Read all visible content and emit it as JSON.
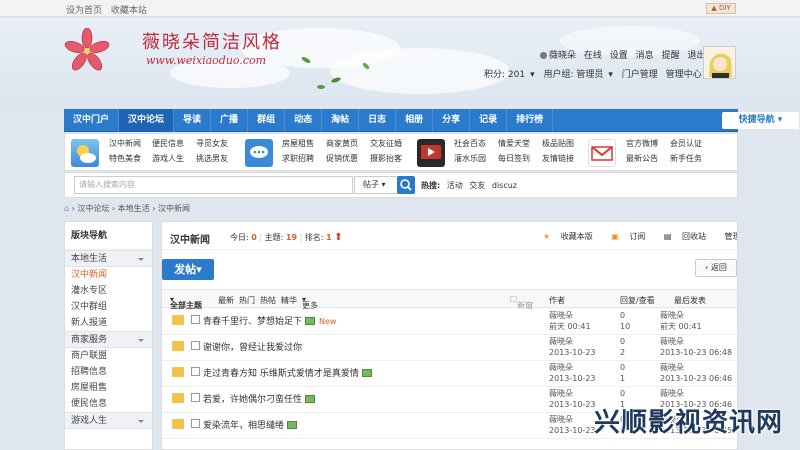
{
  "topbar": {
    "set_home": "设为首页",
    "favorite": "收藏本站",
    "diy": "DIY"
  },
  "logo": {
    "title": "薇晓朵简洁风格",
    "url": "www.weixiaoduo.com"
  },
  "user": {
    "name": "薇晓朵",
    "status": "在线",
    "links": [
      "设置",
      "消息",
      "提醒",
      "退出"
    ],
    "points_label": "积分: 201",
    "group_label": "用户组: 管理员",
    "admin_links": [
      "门户管理",
      "管理中心"
    ]
  },
  "nav": {
    "items": [
      "汉中门户",
      "汉中论坛",
      "导读",
      "广播",
      "群组",
      "动态",
      "淘帖",
      "日志",
      "相册",
      "分享",
      "记录",
      "排行榜"
    ],
    "active_index": 1,
    "quick": "快捷导航"
  },
  "subnav": {
    "col1": [
      "汉中新闻",
      "特色美食"
    ],
    "col2": [
      "便民信息",
      "游戏人生"
    ],
    "col3": [
      "寻觅女友",
      "挑选男友"
    ],
    "col4": [
      "房屋租售",
      "求职招聘"
    ],
    "col5": [
      "商家黄页",
      "促销优惠"
    ],
    "col6": [
      "交友征婚",
      "摄影抬客"
    ],
    "col7": [
      "社会百态",
      "灌水乐园"
    ],
    "col8": [
      "情爱天堂",
      "每日签到"
    ],
    "col9": [
      "极品贴图",
      "友情链接"
    ],
    "col10": [
      "官方微博",
      "最新公告"
    ],
    "col11": [
      "会员认证",
      "新手任务"
    ]
  },
  "search": {
    "placeholder": "请输入搜索内容",
    "type": "帖子",
    "hot_label": "热搜:",
    "hot": [
      "活动",
      "交友",
      "discuz"
    ]
  },
  "breadcrumb": [
    "汉中论坛",
    "本地生活",
    "汉中新闻"
  ],
  "sidebar": {
    "title": "版块导航",
    "groups": [
      {
        "label": "本地生活",
        "items": [
          "汉中新闻",
          "灌水专区",
          "汉中群组",
          "新人报道"
        ]
      },
      {
        "label": "商家服务",
        "items": [
          "商户联盟",
          "招聘信息",
          "房屋租售",
          "便民信息"
        ]
      },
      {
        "label": "游戏人生",
        "items": []
      }
    ],
    "active": "汉中新闻"
  },
  "forum": {
    "name": "汉中新闻",
    "today_label": "今日:",
    "today": "0",
    "topics_label": "主题:",
    "topics": "19",
    "rank_label": "排名:",
    "rank": "1",
    "actions": [
      "收藏本版",
      "订阅",
      "回收站",
      "管理面板"
    ],
    "post_button": "发帖",
    "back_button": "返回",
    "filters": [
      "全部主题",
      "最新",
      "热门",
      "热帖",
      "精华",
      "更多"
    ],
    "new_window": "新窗",
    "col_author": "作者",
    "col_counts": "回复/查看",
    "col_last": "最后发表"
  },
  "threads": [
    {
      "title": "青春千里行、梦想始足下",
      "has_image": true,
      "is_new": true,
      "new_label": "New",
      "author": "薇晓朵",
      "date": "前天 00:41",
      "replies": "0",
      "views": "10",
      "last_by": "薇晓朵",
      "last_time": "前天 00:41"
    },
    {
      "title": "谢谢你，曾经让我爱过你",
      "has_image": false,
      "is_new": false,
      "new_label": "",
      "author": "薇晓朵",
      "date": "2013-10-23",
      "replies": "0",
      "views": "2",
      "last_by": "薇晓朵",
      "last_time": "2013-10-23 06:48"
    },
    {
      "title": "走过青春方知 乐维斯式爱情才是真爱情",
      "has_image": true,
      "is_new": false,
      "new_label": "",
      "author": "薇晓朵",
      "date": "2013-10-23",
      "replies": "0",
      "views": "1",
      "last_by": "薇晓朵",
      "last_time": "2013-10-23 06:46"
    },
    {
      "title": "若爱，许她偶尔刁蛮任性",
      "has_image": true,
      "is_new": false,
      "new_label": "",
      "author": "薇晓朵",
      "date": "2013-10-23",
      "replies": "0",
      "views": "1",
      "last_by": "薇晓朵",
      "last_time": "2013-10-23 06:46"
    },
    {
      "title": "爱染流年，相思缱绻",
      "has_image": true,
      "is_new": false,
      "new_label": "",
      "author": "薇晓朵",
      "date": "2013-10-23",
      "replies": "0",
      "views": "0",
      "last_by": "薇晓朵",
      "last_time": "2013-10-23 06:45"
    }
  ],
  "watermark": "兴顺影视资讯网",
  "colors": {
    "primary": "#2b7acc",
    "accent": "#e05a2b",
    "logo": "#c2273d"
  }
}
